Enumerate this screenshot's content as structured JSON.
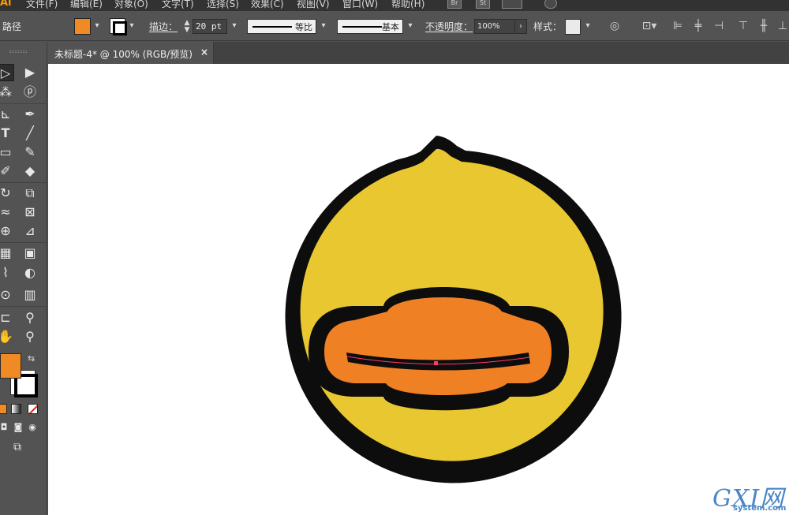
{
  "menubar": {
    "logo": "Ai",
    "items": [
      "文件(F)",
      "编辑(E)",
      "对象(O)",
      "文字(T)",
      "选择(S)",
      "效果(C)",
      "视图(V)",
      "窗口(W)",
      "帮助(H)"
    ],
    "bridge": "Br",
    "stock": "St"
  },
  "controlbar": {
    "object_type": "路径",
    "fill_color": "#f08a24",
    "stroke_label": "描边：",
    "stroke_weight": "20 pt",
    "profile_label": "等比",
    "brush_label": "基本",
    "opacity_label": "不透明度：",
    "opacity_value": "100%",
    "style_label": "样式："
  },
  "tabbar": {
    "doc_title": "未标题-4* @ 100% (RGB/预览)",
    "close_glyph": "×"
  },
  "toolbox": {
    "fill_color": "#f08a24",
    "stroke_color": "#000000",
    "swap_glyph": "⇆"
  },
  "artwork": {
    "body_color": "#e8c731",
    "outline_color": "#0d0d0d",
    "beak_color": "#f08024",
    "path_highlight": "#ff3b6b"
  },
  "watermark": {
    "main": "GXI网",
    "sub": "system.com"
  }
}
